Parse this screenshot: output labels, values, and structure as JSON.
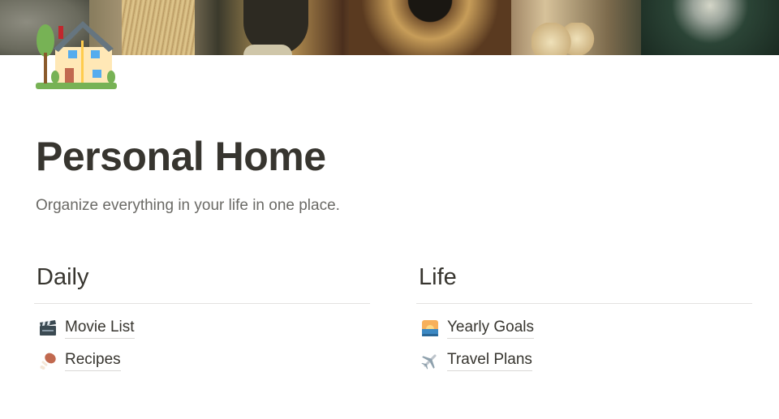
{
  "page": {
    "cover_image": "painting-cover",
    "icon": "house-with-garden-icon",
    "title": "Personal Home",
    "subtitle": "Organize everything in your life in one place."
  },
  "columns": [
    {
      "heading": "Daily",
      "links": [
        {
          "label": "Movie List",
          "icon": "clapper-board-icon"
        },
        {
          "label": "Recipes",
          "icon": "poultry-leg-icon"
        }
      ]
    },
    {
      "heading": "Life",
      "links": [
        {
          "label": "Yearly Goals",
          "icon": "sunrise-icon"
        },
        {
          "label": "Travel Plans",
          "icon": "airplane-icon"
        }
      ]
    }
  ]
}
